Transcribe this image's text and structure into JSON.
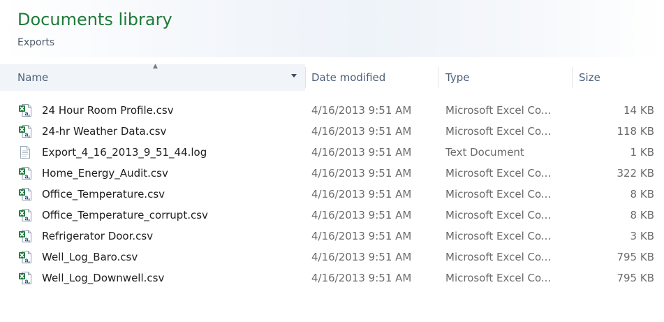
{
  "library": {
    "title": "Documents library",
    "subtitle": "Exports"
  },
  "columns": {
    "name": "Name",
    "date_modified": "Date modified",
    "type": "Type",
    "size": "Size",
    "sort_column": "Name",
    "sort_direction": "ascending"
  },
  "files": [
    {
      "name": "24 Hour Room Profile.csv",
      "date": "4/16/2013 9:51 AM",
      "type": "Microsoft Excel Co...",
      "size": "14 KB",
      "icon": "excel-csv-icon"
    },
    {
      "name": "24-hr Weather Data.csv",
      "date": "4/16/2013 9:51 AM",
      "type": "Microsoft Excel Co...",
      "size": "118 KB",
      "icon": "excel-csv-icon"
    },
    {
      "name": "Export_4_16_2013_9_51_44.log",
      "date": "4/16/2013 9:51 AM",
      "type": "Text Document",
      "size": "1 KB",
      "icon": "text-document-icon"
    },
    {
      "name": "Home_Energy_Audit.csv",
      "date": "4/16/2013 9:51 AM",
      "type": "Microsoft Excel Co...",
      "size": "322 KB",
      "icon": "excel-csv-icon"
    },
    {
      "name": "Office_Temperature.csv",
      "date": "4/16/2013 9:51 AM",
      "type": "Microsoft Excel Co...",
      "size": "8 KB",
      "icon": "excel-csv-icon"
    },
    {
      "name": "Office_Temperature_corrupt.csv",
      "date": "4/16/2013 9:51 AM",
      "type": "Microsoft Excel Co...",
      "size": "8 KB",
      "icon": "excel-csv-icon"
    },
    {
      "name": "Refrigerator Door.csv",
      "date": "4/16/2013 9:51 AM",
      "type": "Microsoft Excel Co...",
      "size": "3 KB",
      "icon": "excel-csv-icon"
    },
    {
      "name": "Well_Log_Baro.csv",
      "date": "4/16/2013 9:51 AM",
      "type": "Microsoft Excel Co...",
      "size": "795 KB",
      "icon": "excel-csv-icon"
    },
    {
      "name": "Well_Log_Downwell.csv",
      "date": "4/16/2013 9:51 AM",
      "type": "Microsoft Excel Co...",
      "size": "795 KB",
      "icon": "excel-csv-icon"
    }
  ],
  "colors": {
    "title_green": "#1f7a3a",
    "header_text": "#4c607a",
    "excel_green": "#1d7a3c"
  }
}
